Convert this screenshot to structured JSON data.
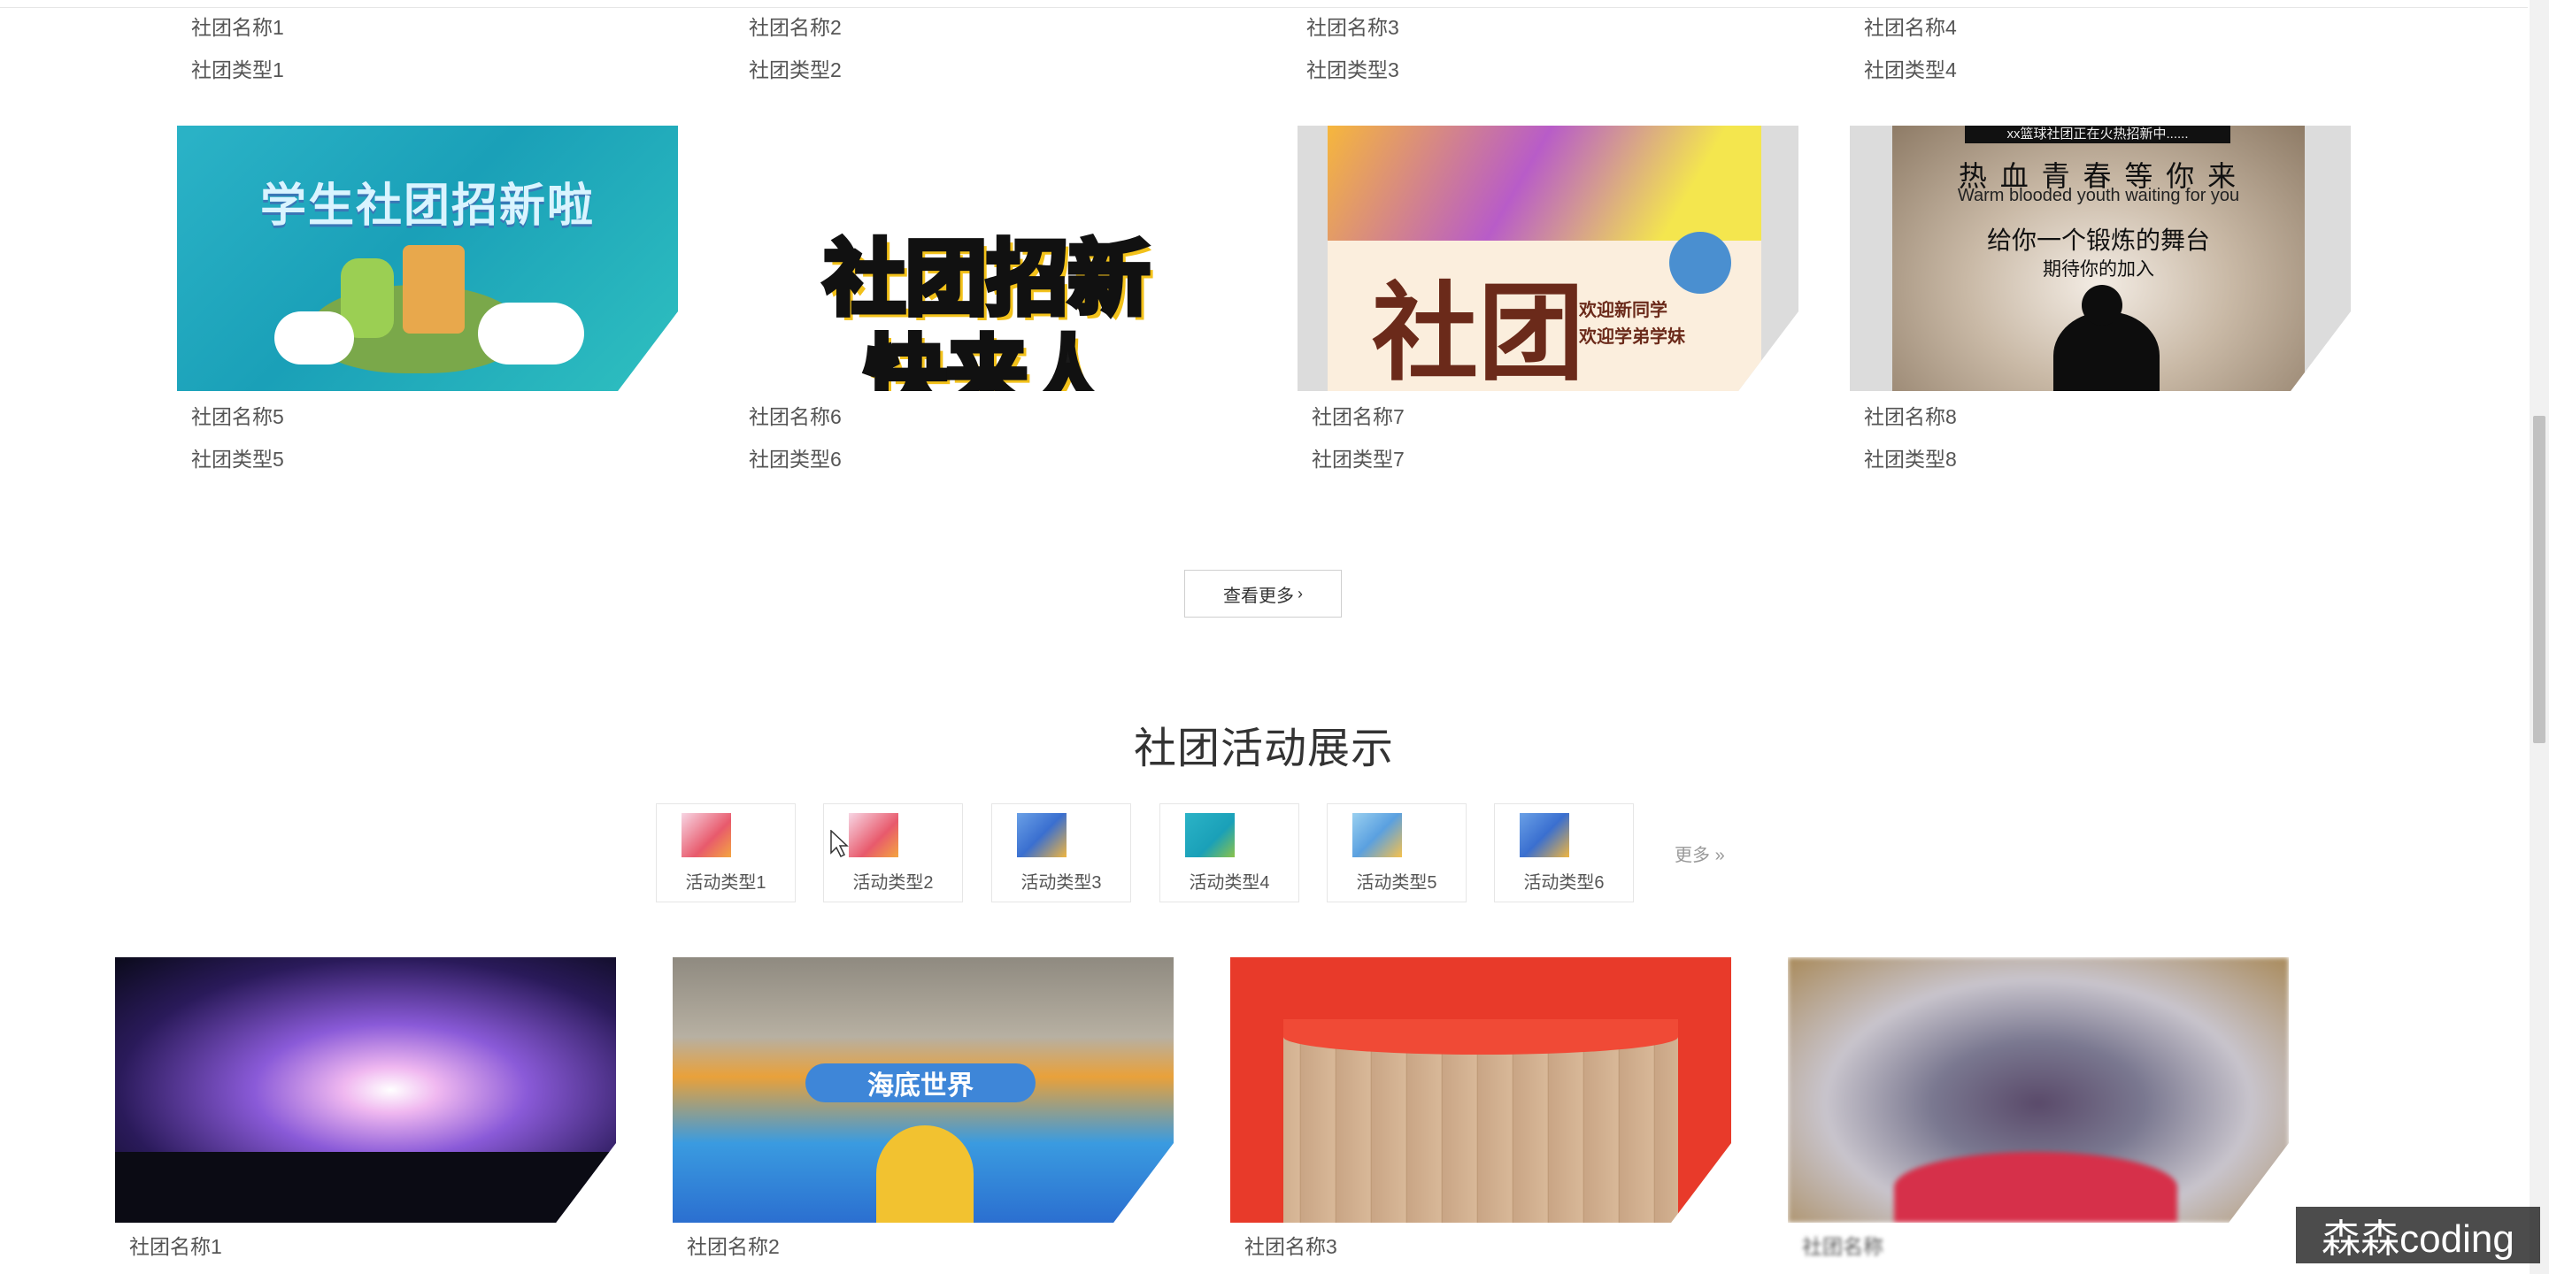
{
  "clubs_row1": [
    {
      "name": "社团名称1",
      "type": "社团类型1"
    },
    {
      "name": "社团名称2",
      "type": "社团类型2"
    },
    {
      "name": "社团名称3",
      "type": "社团类型3"
    },
    {
      "name": "社团名称4",
      "type": "社团类型4"
    }
  ],
  "clubs_row2": [
    {
      "name": "社团名称5",
      "type": "社团类型5",
      "poster_text": "学生社团招新啦"
    },
    {
      "name": "社团名称6",
      "type": "社团类型6",
      "poster_text": "社团招新 快来人"
    },
    {
      "name": "社团名称7",
      "type": "社团类型7",
      "poster_text": "社团",
      "poster_sub1": "欢迎新同学",
      "poster_sub2": "欢迎学弟学妹"
    },
    {
      "name": "社团名称8",
      "type": "社团类型8",
      "poster_top": "xx篮球社团正在火热招新中......",
      "poster_line1": "热 血 青 春 等 你 来",
      "poster_line2": "Warm blooded youth waiting for you",
      "poster_line3": "给你一个锻炼的舞台",
      "poster_line4": "期待你的加入"
    }
  ],
  "more_button": {
    "label": "查看更多",
    "icon": "chevron-right-icon"
  },
  "activity_section": {
    "title": "社团活动展示",
    "types": [
      "活动类型1",
      "活动类型2",
      "活动类型3",
      "活动类型4",
      "活动类型5",
      "活动类型6"
    ],
    "more_label": "更多",
    "more_icon": "double-chevron-right-icon"
  },
  "activities": [
    {
      "name": "社团名称1"
    },
    {
      "name": "社团名称2",
      "poster_text": "海底世界"
    },
    {
      "name": "社团名称3"
    },
    {
      "name": "社团名称"
    }
  ],
  "watermark": "森森coding",
  "colors": {
    "text": "#555555",
    "title": "#333333",
    "border": "#e6e6e6"
  }
}
